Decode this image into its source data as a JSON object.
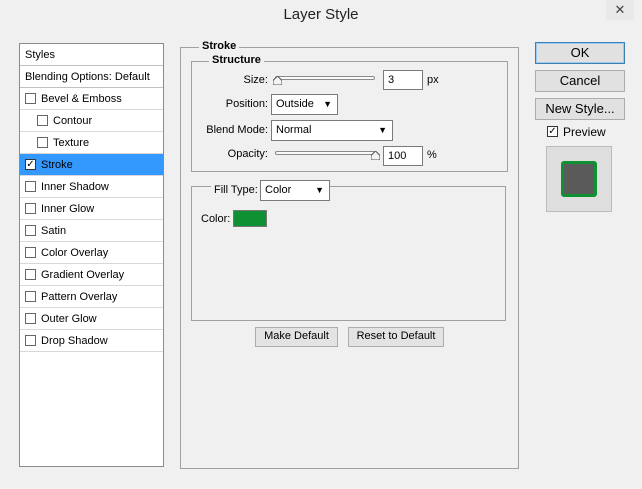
{
  "window": {
    "title": "Layer Style",
    "close_glyph": "✕"
  },
  "sidebar": {
    "items": [
      {
        "label": "Styles",
        "type": "header"
      },
      {
        "label": "Blending Options: Default",
        "type": "header"
      },
      {
        "label": "Bevel & Emboss",
        "checked": false
      },
      {
        "label": "Contour",
        "checked": false,
        "sub": true
      },
      {
        "label": "Texture",
        "checked": false,
        "sub": true
      },
      {
        "label": "Stroke",
        "checked": true,
        "selected": true
      },
      {
        "label": "Inner Shadow",
        "checked": false
      },
      {
        "label": "Inner Glow",
        "checked": false
      },
      {
        "label": "Satin",
        "checked": false
      },
      {
        "label": "Color Overlay",
        "checked": false
      },
      {
        "label": "Gradient Overlay",
        "checked": false
      },
      {
        "label": "Pattern Overlay",
        "checked": false
      },
      {
        "label": "Outer Glow",
        "checked": false
      },
      {
        "label": "Drop Shadow",
        "checked": false
      }
    ],
    "check_glyph": "✓"
  },
  "stroke": {
    "group_label": "Stroke",
    "structure_label": "Structure",
    "size_label": "Size:",
    "size_value": "3",
    "size_unit": "px",
    "size_slider_fraction": 0.0,
    "position_label": "Position:",
    "position_value": "Outside",
    "blend_label": "Blend Mode:",
    "blend_value": "Normal",
    "opacity_label": "Opacity:",
    "opacity_value": "100",
    "opacity_unit": "%",
    "opacity_slider_fraction": 1.0,
    "fill_type_label": "Fill Type:",
    "fill_type_value": "Color",
    "color_label": "Color:",
    "color_value": "#0d9133",
    "make_default": "Make Default",
    "reset_default": "Reset to Default"
  },
  "actions": {
    "ok": "OK",
    "cancel": "Cancel",
    "new_style": "New Style...",
    "preview_label": "Preview",
    "preview_checked": true
  },
  "preview": {
    "fill_color": "#5a5a5a",
    "stroke_color": "#0d9133"
  },
  "colors": {
    "selection": "#3399ff"
  }
}
